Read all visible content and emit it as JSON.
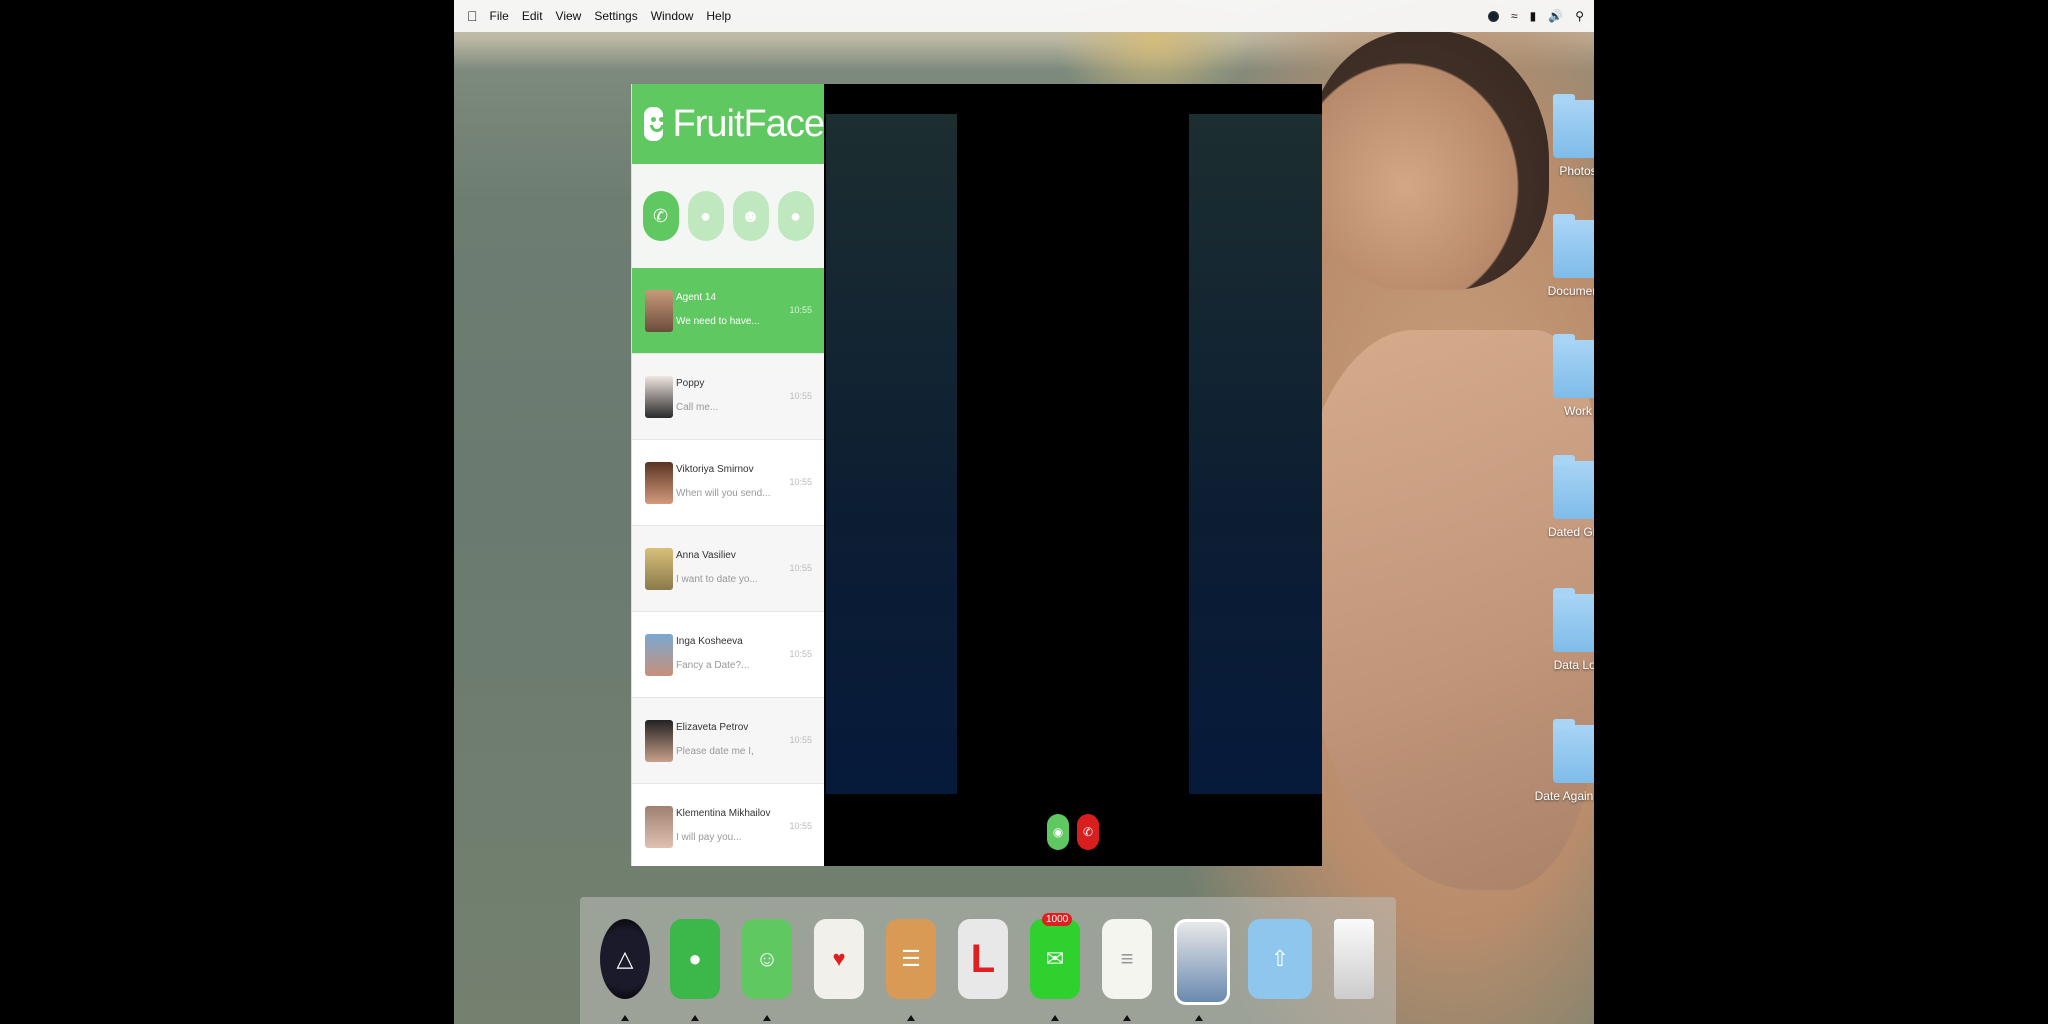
{
  "menubar": {
    "menus": [
      "File",
      "Edit",
      "View",
      "Settings",
      "Window",
      "Help"
    ]
  },
  "app": {
    "name": "FruitFace",
    "contacts": [
      {
        "name": "Agent 14",
        "message": "We need to have...",
        "time": "10:55"
      },
      {
        "name": "Poppy",
        "message": "Call me...",
        "time": "10:55"
      },
      {
        "name": "Viktoriya Smirnov",
        "message": "When will you send...",
        "time": "10:55"
      },
      {
        "name": "Anna Vasiliev",
        "message": "I want to date yo...",
        "time": "10:55"
      },
      {
        "name": "Inga Kosheeva",
        "message": "Fancy a Date?...",
        "time": "10:55"
      },
      {
        "name": "Elizaveta Petrov",
        "message": "Please date me I,",
        "time": "10:55"
      },
      {
        "name": "Klementina Mikhailov",
        "message": "I will pay you...",
        "time": "10:55"
      }
    ]
  },
  "desktop": {
    "folders": [
      "Photos",
      "Documents",
      "Work",
      "Dated Girls",
      "Data Log",
      "Date Again Girls"
    ]
  },
  "dock": {
    "mail_badge": "1000"
  },
  "colors": {
    "accent_green": "#5fc860",
    "decline_red": "#d91e1e",
    "folder_blue": "#8fc6ee"
  }
}
